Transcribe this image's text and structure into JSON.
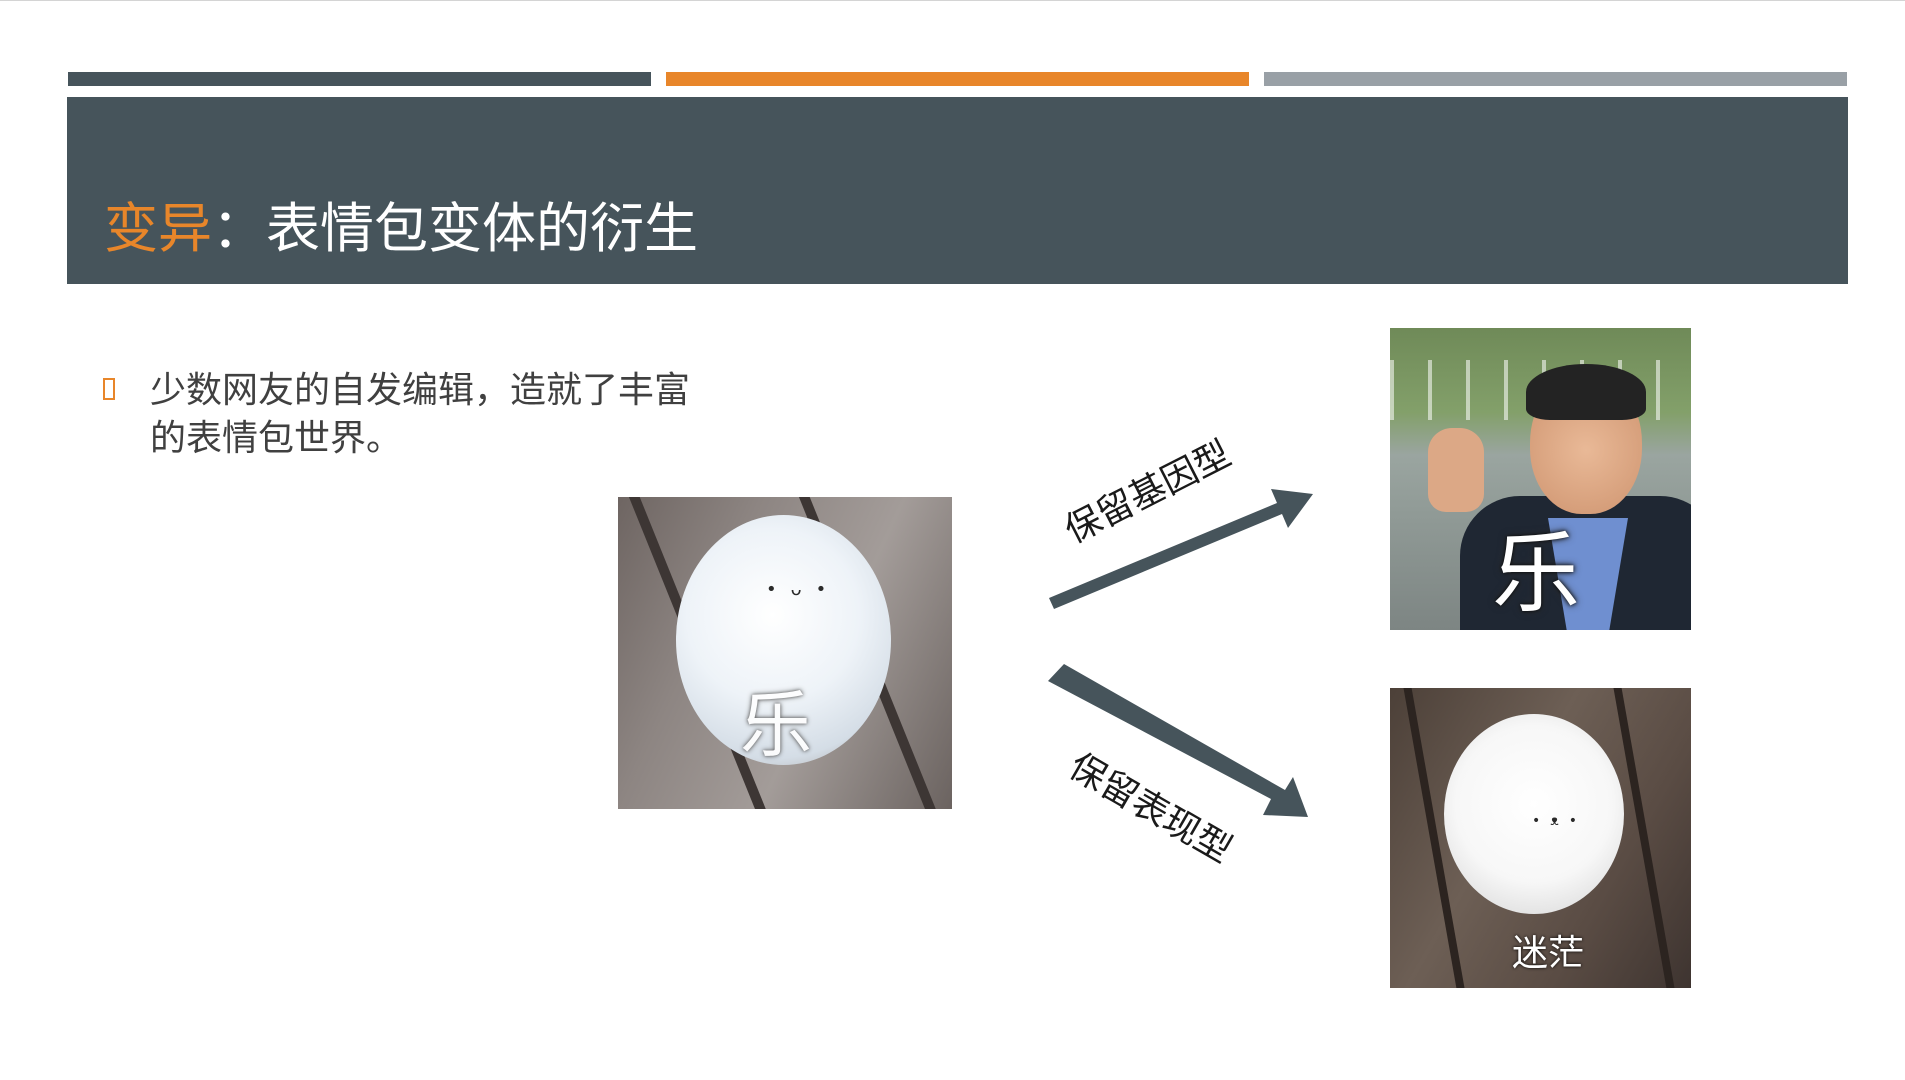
{
  "slide": {
    "title_accent": "变异",
    "title_rest": "：表情包变体的衍生",
    "bullet": "少数网友的自发编辑，造就了丰富的表情包世界。"
  },
  "images": {
    "main_caption": "乐",
    "top_caption": "乐",
    "bottom_caption": "迷茫"
  },
  "arrows": {
    "up_label": "保留基因型",
    "down_label": "保留表现型"
  },
  "colors": {
    "dark": "#46545b",
    "accent": "#e8862a",
    "gray": "#99a0a6"
  }
}
